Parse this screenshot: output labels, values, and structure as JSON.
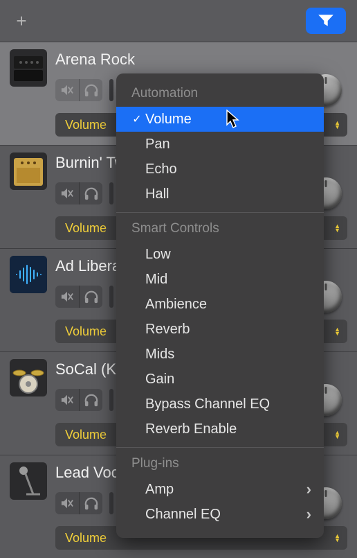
{
  "toolbar": {
    "add_label": "+"
  },
  "tracks": [
    {
      "name": "Arena Rock",
      "param": "Volume",
      "selected": true,
      "icon": "amp-head"
    },
    {
      "name": "Burnin' Tweed",
      "param": "Volume",
      "selected": false,
      "icon": "amp-tweed"
    },
    {
      "name": "Ad Liberate",
      "param": "Volume",
      "selected": false,
      "icon": "audio-wave"
    },
    {
      "name": "SoCal (Kit)",
      "param": "Volume",
      "selected": false,
      "icon": "drum-kit"
    },
    {
      "name": "Lead Vocals",
      "param": "Volume",
      "selected": false,
      "icon": "mic-stand"
    }
  ],
  "menu": {
    "sections": [
      {
        "title": "Automation",
        "items": [
          {
            "label": "Volume",
            "checked": true,
            "highlight": true
          },
          {
            "label": "Pan"
          },
          {
            "label": "Echo"
          },
          {
            "label": "Hall"
          }
        ]
      },
      {
        "title": "Smart Controls",
        "items": [
          {
            "label": "Low"
          },
          {
            "label": "Mid"
          },
          {
            "label": "Ambience"
          },
          {
            "label": "Reverb"
          },
          {
            "label": "Mids"
          },
          {
            "label": "Gain"
          },
          {
            "label": "Bypass Channel EQ"
          },
          {
            "label": "Reverb Enable"
          }
        ]
      },
      {
        "title": "Plug-ins",
        "items": [
          {
            "label": "Amp",
            "submenu": true
          },
          {
            "label": "Channel EQ",
            "submenu": true
          }
        ]
      }
    ]
  }
}
